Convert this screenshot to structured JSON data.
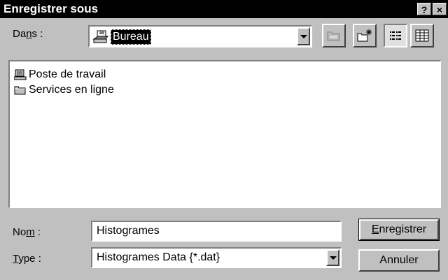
{
  "window": {
    "title": "Enregistrer sous",
    "help_label": "?",
    "close_label": "×"
  },
  "location": {
    "label_pre": "Da",
    "label_accel": "n",
    "label_post": "s :",
    "value": "Bureau"
  },
  "files": [
    {
      "name": "Poste de travail",
      "icon": "computer-icon"
    },
    {
      "name": "Services en ligne",
      "icon": "folder-icon"
    }
  ],
  "filename": {
    "label_pre": "No",
    "label_accel": "m",
    "label_post": " :",
    "value": "Histogrames"
  },
  "filetype": {
    "label_accel": "T",
    "label_post": "ype :",
    "value": "Histogrames Data {*.dat}"
  },
  "buttons": {
    "save_accel": "E",
    "save_rest": "nregistrer",
    "cancel": "Annuler"
  }
}
